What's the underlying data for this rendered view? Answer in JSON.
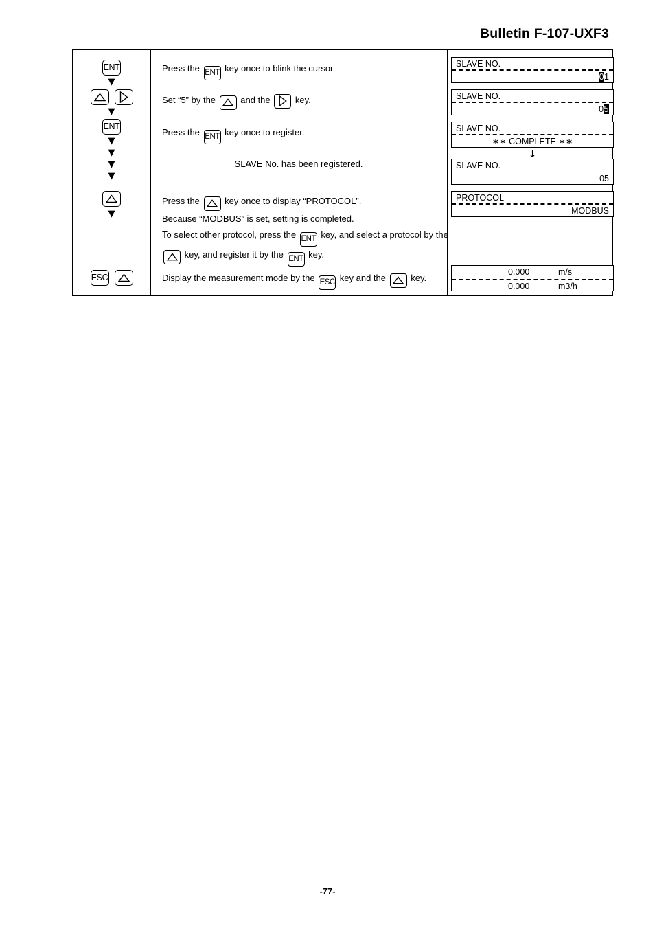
{
  "header": {
    "bulletin_title": "Bulletin F-107-UXF3"
  },
  "footer": {
    "page_number": "-77-"
  },
  "procedure": {
    "key_sequence": [
      {
        "name": "ent-1",
        "keys": [
          "ENT"
        ]
      },
      {
        "name": "up-right",
        "keys": [
          "UP",
          "RIGHT"
        ]
      },
      {
        "name": "ent-2",
        "keys": [
          "ENT"
        ]
      },
      {
        "name": "up-1",
        "keys": [
          "UP"
        ]
      },
      {
        "name": "esc-up",
        "keys": [
          "ESC",
          "UP"
        ]
      }
    ],
    "key_labels": {
      "ent": "ENT",
      "esc": "ESC",
      "up": "up-triangle",
      "right": "right-triangle"
    },
    "arrow_glyph": "▼",
    "instructions": [
      {
        "id": "l1",
        "pre": "Press the ",
        "key": "ENT",
        "post": " key once to blink the cursor."
      },
      {
        "id": "l2",
        "pre": "Set “5” by the ",
        "key": "UP",
        "mid": " and the ",
        "key2": "RIGHT",
        "post": " key."
      },
      {
        "id": "l3",
        "pre": "Press the ",
        "key": "ENT",
        "post": " key once to register."
      },
      {
        "id": "l4",
        "text": "SLAVE No. has been registered."
      },
      {
        "id": "l5",
        "pre": "Press the ",
        "key": "UP",
        "post": " key once to display “PROTOCOL”."
      },
      {
        "id": "l6",
        "text": "Because “MODBUS” is set, setting is completed."
      },
      {
        "id": "l7",
        "pre": "To select other protocol, press the ",
        "key": "ENT",
        "post": " key, and select a protocol by the"
      },
      {
        "id": "l8",
        "pre": "",
        "key": "UP",
        "post": " key, and register it by the ",
        "key2": "ENT",
        "post2": " key."
      },
      {
        "id": "l9",
        "pre": "Display the measurement mode by the ",
        "key": "ESC",
        "post": " key and the ",
        "key2": "UP",
        "post2": " key."
      }
    ],
    "lcd_panels": [
      {
        "id": "lcd1",
        "title": "SLAVE NO.",
        "value_prefix": "",
        "cursor_char": "0",
        "value_suffix": "1"
      },
      {
        "id": "lcd2",
        "title": "SLAVE NO.",
        "value_prefix": "0",
        "cursor_char": "5",
        "value_suffix": ""
      },
      {
        "id": "lcd3",
        "title": "SLAVE NO.",
        "value_centered": "∗∗ COMPLETE ∗∗"
      },
      {
        "id": "lcd4",
        "title": "SLAVE NO.",
        "value_plain": "05"
      },
      {
        "id": "lcd5",
        "title": "PROTOCOL",
        "value_plain": "MODBUS"
      }
    ],
    "lcd_transition_arrow": "↓",
    "measurement_display": {
      "row1_value": "0.000",
      "row1_unit": "m/s",
      "row2_value": "0.000",
      "row2_unit": "m3/h"
    }
  }
}
